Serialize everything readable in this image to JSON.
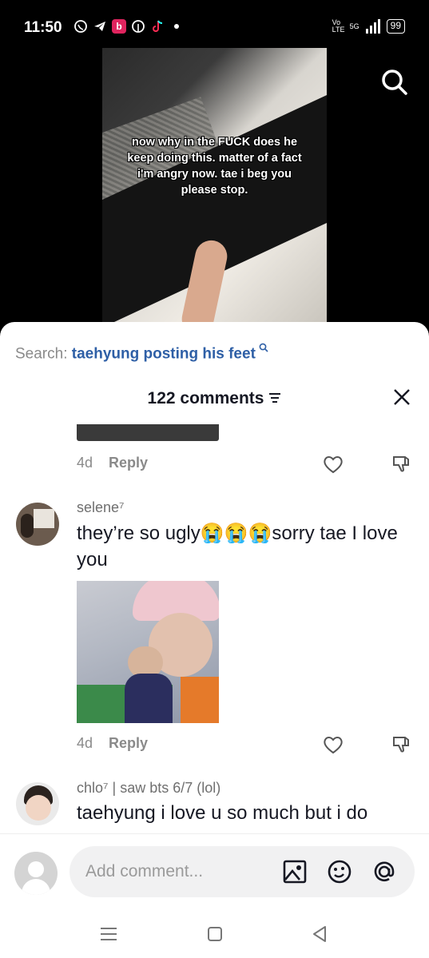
{
  "status_bar": {
    "time": "11:50",
    "net": "5G",
    "volte": "Vo LTE",
    "battery": "99"
  },
  "video": {
    "caption": "now why in the FUCK does he keep doing this. matter of a fact i'm angry now. tae i beg you please stop."
  },
  "sheet": {
    "search_label": "Search:",
    "search_keyword": "taehyung posting his feet",
    "comment_count": "122 comments"
  },
  "comments": [
    {
      "age": "4d",
      "reply": "Reply"
    },
    {
      "username": "selene⁷",
      "text": "they’re so ugly😭😭😭sorry tae I love you",
      "age": "4d",
      "reply": "Reply"
    },
    {
      "username": "chlo⁷ | saw bts 6/7 (lol)",
      "text": "taehyung i love u so much but i do"
    }
  ],
  "composer": {
    "placeholder": "Add comment..."
  },
  "colors": {
    "accent_link": "#2e5fa6",
    "text_primary": "#161823",
    "text_secondary": "#8a8a8a"
  },
  "icons": [
    "whatsapp-icon",
    "telegram-icon",
    "b-app-icon",
    "pinterest-icon",
    "tiktok-icon",
    "search-icon",
    "close-icon",
    "filter-icon",
    "heart-icon",
    "dislike-icon",
    "image-icon",
    "emoji-icon",
    "mention-icon",
    "menu-icon",
    "home-icon",
    "back-icon"
  ]
}
